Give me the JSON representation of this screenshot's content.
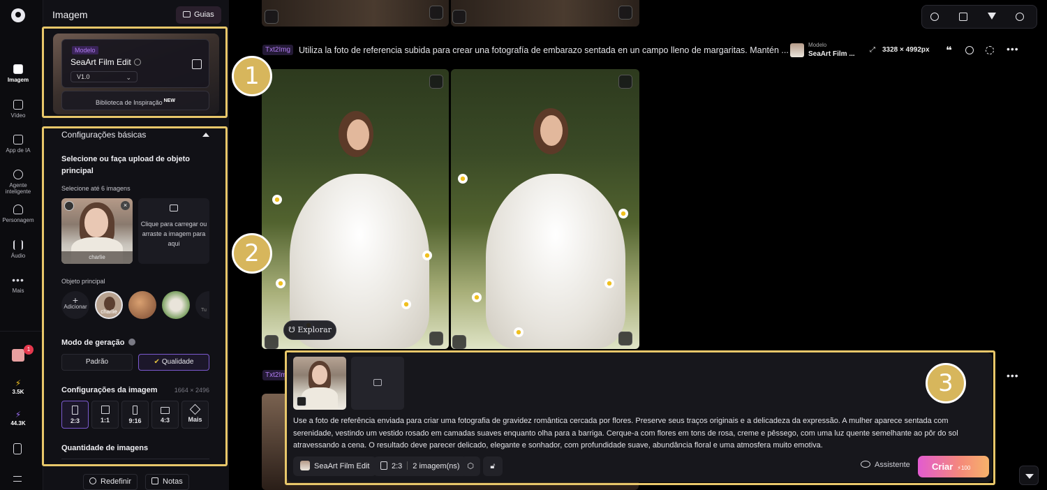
{
  "rail": {
    "items": [
      {
        "label": "Imagem",
        "icon": "image-icon",
        "active": true
      },
      {
        "label": "Vídeo",
        "icon": "video-icon"
      },
      {
        "label": "App de IA",
        "icon": "ai-app-icon"
      },
      {
        "label": "Agente inteligente",
        "icon": "agent-icon"
      },
      {
        "label": "Personagem",
        "icon": "character-icon"
      },
      {
        "label": "Áudio",
        "icon": "audio-icon"
      },
      {
        "label": "Mais",
        "icon": "more-icon"
      }
    ],
    "gift_badge": "1",
    "credits_a": "3.5K",
    "credits_b": "44.3K"
  },
  "panel": {
    "title": "Imagem",
    "guides_label": "Guias",
    "model": {
      "tag": "Modelo",
      "name": "SeaArt Film Edit",
      "version": "V1.0",
      "inspiration_label": "Biblioteca de Inspiração",
      "inspiration_badge": "NEW"
    },
    "basic_settings": "Configurações básicas",
    "subject_heading": "Selecione ou faça upload de objeto principal",
    "subject_sub": "Selecione até 6 imagens",
    "uploaded_name": "charlie",
    "upload_hint": "Clique para carregar ou arraste a imagem para aqui",
    "main_object_label": "Objeto principal",
    "add_label": "Adicionar",
    "charlie_label": "charlie",
    "more_label": "Tu",
    "gen_mode_label": "Modo de geração",
    "mode_standard": "Padrão",
    "mode_quality": "Qualidade",
    "image_settings_label": "Configurações da imagem",
    "image_dims": "1664 × 2496",
    "ratios": [
      "2:3",
      "1:1",
      "9:16",
      "4:3",
      "Mais"
    ],
    "quantity_label": "Quantidade de imagens",
    "reset_label": "Redefinir",
    "notes_label": "Notas"
  },
  "callouts": [
    "1",
    "2",
    "3"
  ],
  "feed": {
    "tag": "Txt2Img",
    "tag_short": "Txt2Im",
    "prompt_preview": "Utiliza la foto de referencia subida para crear una fotografía de embarazo sentada en un campo lleno de margaritas. Mantén ...",
    "model_label": "Modelo",
    "model_name": "SeaArt Film ...",
    "dimensions": "3328 × 4992px",
    "explore_label": "Explorar"
  },
  "prompt_box": {
    "text": "Use a foto de referência enviada para criar uma fotografia de gravidez romântica cercada por flores. Preserve seus traços originais e a delicadeza da expressão. A mulher aparece sentada com serenidade, vestindo um vestido rosado em camadas suaves enquanto olha para a barriga. Cerque-a com flores em tons de rosa, creme e pêssego, com uma luz quente semelhante ao pôr do sol atravessando a cena. O resultado deve parecer delicado, elegante e sonhador, com profundidade suave, abundância floral e uma atmosfera muito emotiva.",
    "model_chip": "SeaArt Film Edit",
    "ratio_chip": "2:3",
    "count_chip": "2 imagem(ns)",
    "assistant_label": "Assistente",
    "create_label": "Criar",
    "create_cost": "⚡100"
  },
  "colors": {
    "highlight": "#e8c76a",
    "accent_purple": "#7c5ad0",
    "create_gradient_start": "#e25bd0",
    "create_gradient_end": "#f7b36a"
  }
}
